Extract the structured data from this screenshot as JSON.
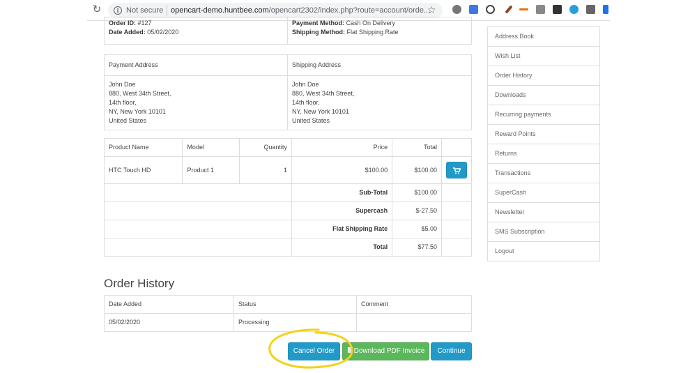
{
  "browser": {
    "security_text": "Not secure",
    "url_host": "opencart-demo.huntbee.com",
    "url_path": "/opencart2302/index.php?route=account/orde..."
  },
  "order_info": {
    "order_id_label": "Order ID:",
    "order_id": "#127",
    "date_added_label": "Date Added:",
    "date_added": "05/02/2020",
    "payment_method_label": "Payment Method:",
    "payment_method": "Cash On Delivery",
    "shipping_method_label": "Shipping Method:",
    "shipping_method": "Flat Shipping Rate"
  },
  "addresses": {
    "payment_header": "Payment Address",
    "shipping_header": "Shipping Address",
    "payment_lines": [
      "John Doe",
      "880, West 34th Street,",
      "14th floor,",
      "NY, New York 10101",
      "United States"
    ],
    "shipping_lines": [
      "John Doe",
      "880, West 34th Street,",
      "14th floor,",
      "NY, New York 10101",
      "United States"
    ]
  },
  "products": {
    "headers": [
      "Product Name",
      "Model",
      "Quantity",
      "Price",
      "Total"
    ],
    "rows": [
      {
        "name": "HTC Touch HD",
        "model": "Product 1",
        "quantity": "1",
        "price": "$100.00",
        "total": "$100.00"
      }
    ],
    "totals": [
      {
        "label": "Sub-Total",
        "value": "$100.00"
      },
      {
        "label": "Supercash",
        "value": "$-27.50"
      },
      {
        "label": "Flat Shipping Rate",
        "value": "$5.00"
      },
      {
        "label": "Total",
        "value": "$77.50"
      }
    ]
  },
  "history": {
    "title": "Order History",
    "headers": [
      "Date Added",
      "Status",
      "Comment"
    ],
    "rows": [
      {
        "date": "05/02/2020",
        "status": "Processing",
        "comment": ""
      }
    ]
  },
  "buttons": {
    "cancel": "Cancel Order",
    "pdf": "Download PDF Invoice",
    "continue": "Continue"
  },
  "sidebar": {
    "items": [
      "Address Book",
      "Wish List",
      "Order History",
      "Downloads",
      "Recurring payments",
      "Reward Points",
      "Returns",
      "Transactions",
      "SuperCash",
      "Newsletter",
      "SMS Subscription",
      "Logout"
    ]
  },
  "colors": {
    "primary": "#229ac8",
    "success": "#5bb75b",
    "highlight": "#f2d21b"
  }
}
